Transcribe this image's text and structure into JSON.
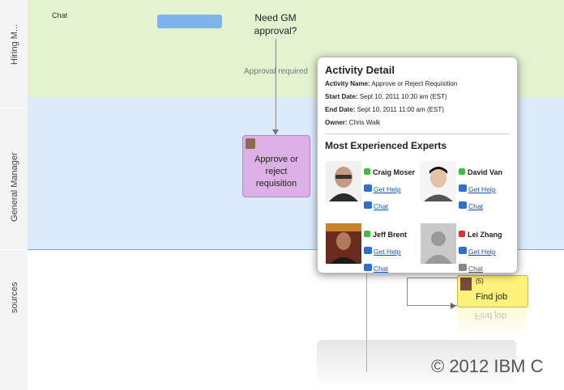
{
  "lanes": {
    "hiring": "Hiring M...",
    "gm": "General Manager",
    "resources": "sources"
  },
  "diagram": {
    "decision_text": "Need GM\napproval?",
    "decision_top": "Need GM",
    "decision_bottom": "approval?",
    "top_left_text": "Chat",
    "approval_required": "Approval required",
    "task_approve": "Approve or reject requisition",
    "task_find_job": "Find job",
    "find_job_count": "(5)"
  },
  "popup": {
    "title": "Activity Detail",
    "activity_name_label": "Activity Name:",
    "activity_name": "Approve or Reject Requisition",
    "start_label": "Start Date:",
    "start_value": "Sept 10, 2011 10:30 am (EST)",
    "end_label": "End Date:",
    "end_value": "Sept 10, 2011 11:00 am (EST)",
    "owner_label": "Owner:",
    "owner_value": "Chris Walk",
    "experts_title": "Most Experienced Experts",
    "experts": [
      {
        "name": "Craig Moser",
        "status_color": "#3cbf3c",
        "get_help": "Get Help",
        "chat": "Chat"
      },
      {
        "name": "David Van",
        "status_color": "#3cbf3c",
        "get_help": "Get Help",
        "chat": "Chat"
      },
      {
        "name": "Jeff Brent",
        "status_color": "#3cbf3c",
        "get_help": "Get Help",
        "chat": "Chat"
      },
      {
        "name": "Lei Zhang",
        "status_color": "#e03030",
        "get_help": "Get Help",
        "chat": "Chat"
      }
    ]
  },
  "copyright": "© 2012 IBM C"
}
